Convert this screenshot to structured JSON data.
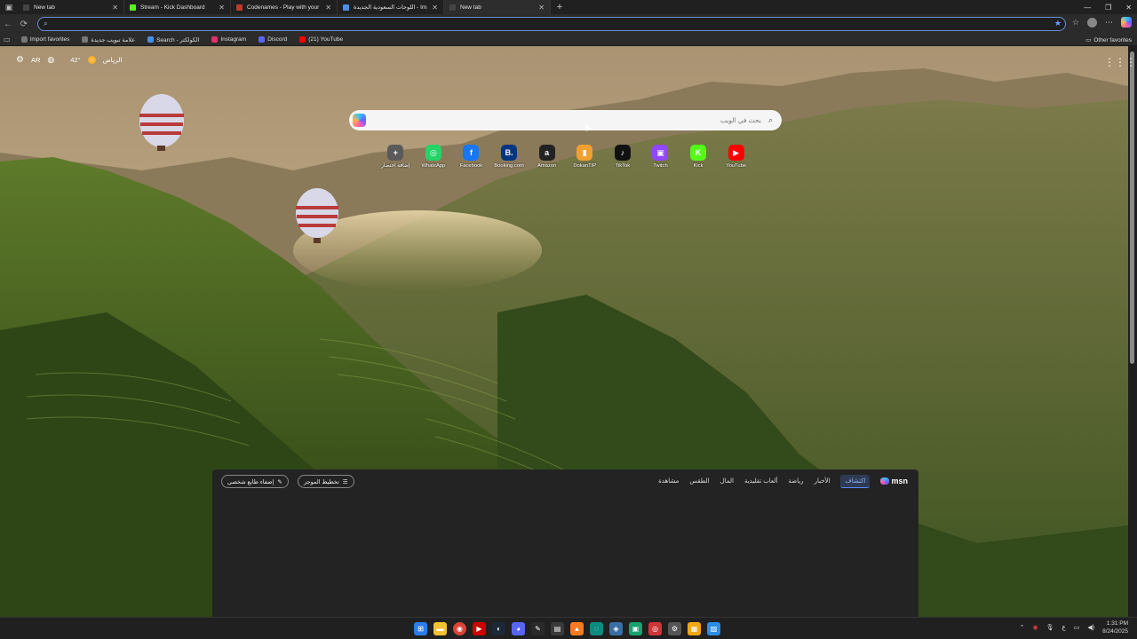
{
  "tabs": [
    {
      "title": "New tab",
      "active": false,
      "color": "#444444"
    },
    {
      "title": "Stream - Kick Dashboard",
      "active": false,
      "color": "#53fc18"
    },
    {
      "title": "Codenames - Play with your Frien",
      "active": false,
      "color": "#c0392b"
    },
    {
      "title": "اللوحات السعودية الجديدة - Images",
      "active": false,
      "color": "#4a90e2"
    },
    {
      "title": "New tab",
      "active": true,
      "color": "#444444"
    }
  ],
  "address": {
    "value": "",
    "placeholder": ""
  },
  "bookmarks": [
    {
      "label": "Import favorites",
      "color": "#777777"
    },
    {
      "label": "علامة تبويب جديدة",
      "color": "#777777"
    },
    {
      "label": "Search - الكولكتر",
      "color": "#4a90e2"
    },
    {
      "label": "Instagram",
      "color": "#e1306c"
    },
    {
      "label": "Discord",
      "color": "#5865f2"
    },
    {
      "label": "(21) YouTube",
      "color": "#ff0000"
    }
  ],
  "bookmarks_other": "Other favorites",
  "weather": {
    "lang": "AR",
    "temp": "42°",
    "city": "الرياض"
  },
  "search": {
    "placeholder": "بحث في الويب"
  },
  "tiles": [
    {
      "label": "إضافة اختصار",
      "glyph": "+",
      "color": "#5a5a5a"
    },
    {
      "label": "WhatsApp",
      "glyph": "◎",
      "color": "#25d366"
    },
    {
      "label": "Facebook",
      "glyph": "f",
      "color": "#1877f2"
    },
    {
      "label": "Booking.com",
      "glyph": "B.",
      "color": "#003580"
    },
    {
      "label": "Amazon",
      "glyph": "a",
      "color": "#222222"
    },
    {
      "label": "DokanTIP",
      "glyph": "▮",
      "color": "#f0a030"
    },
    {
      "label": "TikTok",
      "glyph": "♪",
      "color": "#111111"
    },
    {
      "label": "Twitch",
      "glyph": "▣",
      "color": "#9146ff"
    },
    {
      "label": "Kick",
      "glyph": "K",
      "color": "#53fc18"
    },
    {
      "label": "YouTube",
      "glyph": "▶",
      "color": "#ff0000"
    }
  ],
  "feed": {
    "personalize": "إضفاء طابع شخصي",
    "layout": "تخطيط الموجز",
    "categories": [
      "اكتشاف",
      "الأخبار",
      "رياضة",
      "ألعاب تقليدية",
      "المال",
      "الطقس",
      "مشاهدة"
    ],
    "brand": "msn"
  },
  "clock": {
    "time": "1:31 PM",
    "date": "8/24/2025"
  },
  "tray_lang": "ع"
}
